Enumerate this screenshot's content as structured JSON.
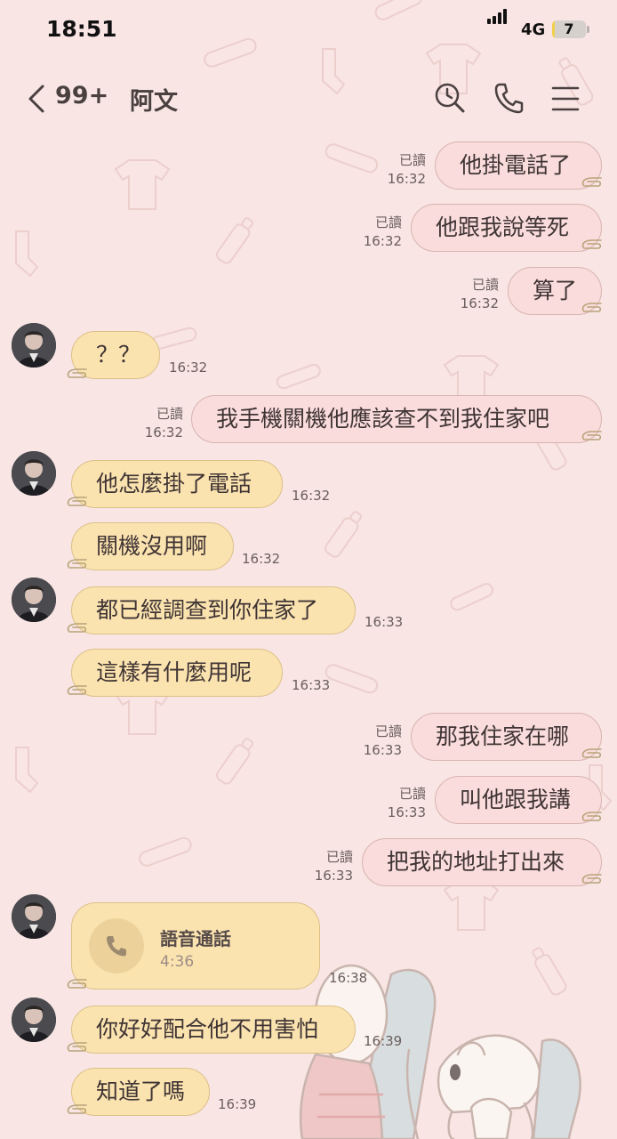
{
  "status_bar": {
    "time": "18:51",
    "network": "4G",
    "battery": "7",
    "battery_level": 0.07
  },
  "header": {
    "unread_count": "99+",
    "contact_name": "阿文"
  },
  "read_label": "已讀",
  "messages": [
    {
      "text": "他掛電話了",
      "time": "16:32"
    },
    {
      "text": "他跟我說等死",
      "time": "16:32"
    },
    {
      "text": "算了",
      "time": "16:32"
    },
    {
      "text": "？？",
      "time": "16:32"
    },
    {
      "text": "我手機關機他應該查不到我住家吧",
      "time": "16:32"
    },
    {
      "text": "他怎麼掛了電話",
      "time": "16:32"
    },
    {
      "text": "關機沒用啊",
      "time": "16:32"
    },
    {
      "text": "都已經調查到你住家了",
      "time": "16:33"
    },
    {
      "text": "這樣有什麼用呢",
      "time": "16:33"
    },
    {
      "text": "那我住家在哪",
      "time": "16:33"
    },
    {
      "text": "叫他跟我講",
      "time": "16:33"
    },
    {
      "text": "把我的地址打出來",
      "time": "16:33"
    },
    {
      "title": "語音通話",
      "duration": "4:36",
      "time": "16:38"
    },
    {
      "text": "你好好配合他不用害怕",
      "time": "16:39"
    },
    {
      "text": "知道了嗎",
      "time": "16:39"
    }
  ]
}
